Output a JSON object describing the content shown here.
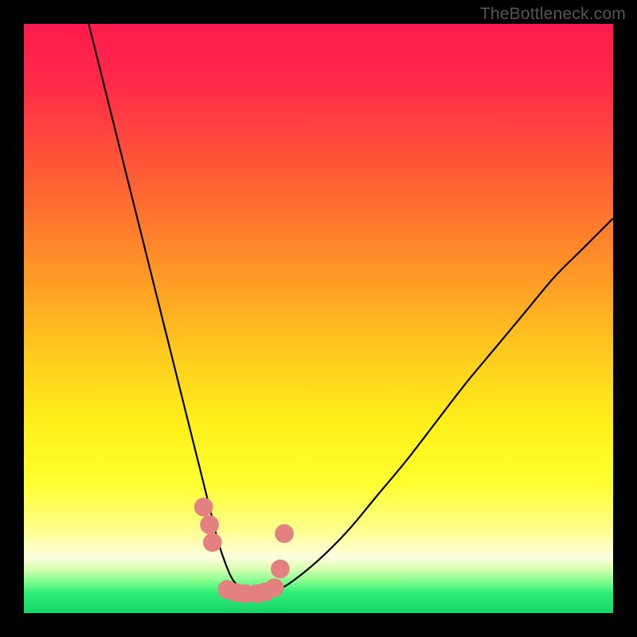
{
  "watermark": "TheBottleneck.com",
  "gradient_stops": [
    {
      "offset": 0.0,
      "color": "#ff1a4e"
    },
    {
      "offset": 0.1,
      "color": "#ff2a48"
    },
    {
      "offset": 0.25,
      "color": "#ff5a36"
    },
    {
      "offset": 0.4,
      "color": "#ff8f28"
    },
    {
      "offset": 0.55,
      "color": "#ffc71f"
    },
    {
      "offset": 0.68,
      "color": "#fff01a"
    },
    {
      "offset": 0.78,
      "color": "#ffff30"
    },
    {
      "offset": 0.86,
      "color": "#ffff90"
    },
    {
      "offset": 0.905,
      "color": "#ffffe0"
    },
    {
      "offset": 0.925,
      "color": "#d8ffb0"
    },
    {
      "offset": 0.945,
      "color": "#88ff90"
    },
    {
      "offset": 0.965,
      "color": "#30ef78"
    },
    {
      "offset": 1.0,
      "color": "#18d268"
    }
  ],
  "chart_data": {
    "type": "line",
    "title": "",
    "xlabel": "",
    "ylabel": "",
    "xlim": [
      0,
      100
    ],
    "ylim": [
      0,
      100
    ],
    "series": [
      {
        "name": "curve",
        "x": [
          11,
          14,
          17,
          20,
          22,
          24,
          26,
          28,
          30,
          31,
          32,
          33,
          34,
          35,
          36,
          38,
          40,
          42,
          45,
          50,
          55,
          60,
          65,
          70,
          75,
          80,
          85,
          90,
          95,
          100
        ],
        "y": [
          100,
          88,
          76,
          64,
          56,
          48,
          40,
          32,
          24,
          20,
          16,
          12,
          9,
          6.5,
          5,
          3.5,
          3,
          3.5,
          5,
          9,
          14,
          20,
          26,
          32.5,
          39,
          45,
          51,
          57,
          62,
          67
        ]
      },
      {
        "name": "markers",
        "x": [
          30.5,
          31.5,
          32.0,
          34.5,
          36.0,
          37.5,
          39.5,
          41.0,
          42.5,
          43.5,
          44.2
        ],
        "y": [
          18,
          15,
          12,
          4.0,
          3.5,
          3.3,
          3.3,
          3.6,
          4.3,
          7.5,
          13.5
        ]
      }
    ],
    "marker_style": {
      "color": "#e58080",
      "radius_pct": 1.6
    }
  }
}
